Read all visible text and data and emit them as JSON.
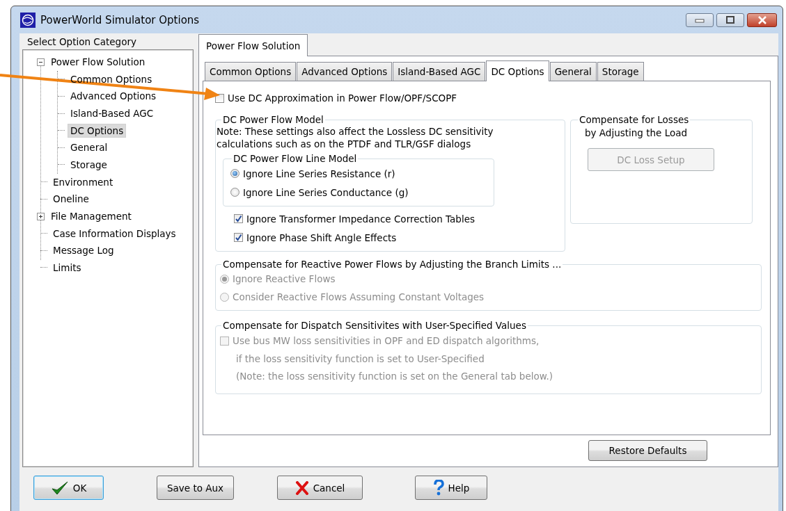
{
  "window": {
    "title": "PowerWorld Simulator Options"
  },
  "category_panel": {
    "title": "Select Option Category",
    "tree": [
      {
        "label": "Power Flow Solution",
        "expanded": true,
        "selected": false,
        "children": [
          {
            "label": "Common Options",
            "selected": false
          },
          {
            "label": "Advanced Options",
            "selected": false
          },
          {
            "label": "Island-Based AGC",
            "selected": false
          },
          {
            "label": "DC Options",
            "selected": true
          },
          {
            "label": "General",
            "selected": false
          },
          {
            "label": "Storage",
            "selected": false
          }
        ]
      },
      {
        "label": "Environment",
        "selected": false
      },
      {
        "label": "Oneline",
        "selected": false
      },
      {
        "label": "File Management",
        "expanded": false,
        "selected": false
      },
      {
        "label": "Case Information Displays",
        "selected": false
      },
      {
        "label": "Message Log",
        "selected": false
      },
      {
        "label": "Limits",
        "selected": false
      }
    ]
  },
  "page_tabs": [
    {
      "label": "Power Flow Solution",
      "selected": true
    }
  ],
  "sub_tabs": [
    {
      "label": "Common Options",
      "selected": false
    },
    {
      "label": "Advanced Options",
      "selected": false
    },
    {
      "label": "Island-Based AGC",
      "selected": false
    },
    {
      "label": "DC Options",
      "selected": true
    },
    {
      "label": "General",
      "selected": false
    },
    {
      "label": "Storage",
      "selected": false
    }
  ],
  "dc_approximation": {
    "label": "Use DC Approximation in Power Flow/OPF/SCOPF",
    "checked": false
  },
  "dc_model": {
    "title": "DC Power Flow Model",
    "note_lines": [
      "Note: These settings also affect the Lossless DC sensitivity",
      "calculations such as on the PTDF and TLR/GSF dialogs"
    ],
    "line_model": {
      "title": "DC Power Flow Line Model",
      "options": [
        {
          "label": "Ignore Line Series Resistance (r)",
          "selected": true
        },
        {
          "label": "Ignore Line Series Conductance (g)",
          "selected": false
        }
      ]
    },
    "checks": [
      {
        "label": "Ignore Transformer Impedance Correction Tables",
        "checked": true
      },
      {
        "label": "Ignore Phase Shift Angle Effects",
        "checked": true
      }
    ]
  },
  "losses": {
    "title": "Compensate for Losses",
    "subtitle": "by Adjusting the Load",
    "button": {
      "label": "DC Loss Setup",
      "disabled": true
    }
  },
  "reactive": {
    "title": "Compensate for Reactive Power Flows by Adjusting the Branch Limits ...",
    "disabled": true,
    "options": [
      {
        "label": "Ignore Reactive Flows",
        "selected": true
      },
      {
        "label": "Consider Reactive Flows Assuming Constant Voltages",
        "selected": false
      }
    ]
  },
  "dispatch": {
    "title": "Compensate for Dispatch Sensitivites with User-Specified Values",
    "disabled": true,
    "checkbox": {
      "label": "Use bus MW loss sensitivities in OPF and ED dispatch algorithms,",
      "checked": false
    },
    "notes": [
      "if the loss sensitivity function is set to User-Specified",
      "(Note: the loss sensitivity function is set on the General tab below.)"
    ]
  },
  "restore_button": {
    "label": "Restore Defaults"
  },
  "buttons": [
    {
      "label": "OK",
      "kind": "ok",
      "default": true
    },
    {
      "label": "Save to Aux",
      "kind": "save",
      "default": false
    },
    {
      "label": "Cancel",
      "kind": "cancel",
      "default": false
    },
    {
      "label": "Help",
      "kind": "help",
      "default": false
    }
  ]
}
